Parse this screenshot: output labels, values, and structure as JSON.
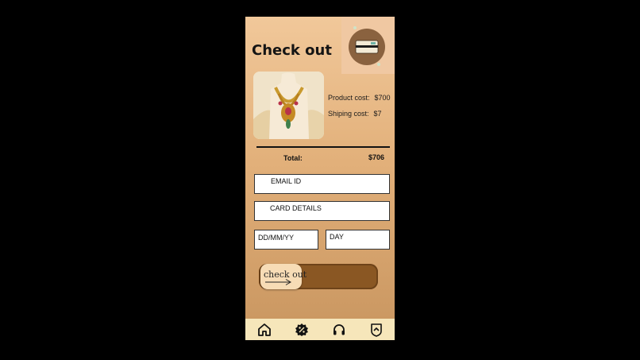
{
  "page": {
    "title": "Check out"
  },
  "product": {
    "product_cost_label": "Product cost:",
    "product_cost_value": "$700",
    "shipping_cost_label": "Shiping cost:",
    "shipping_cost_value": "$7"
  },
  "summary": {
    "total_label": "Total:",
    "total_value": "$706"
  },
  "form": {
    "email_label": "EMAIL ID",
    "card_label": "CARD DETAILS",
    "date_label": "DD/MM/YY",
    "day_label": "DAY"
  },
  "checkout": {
    "button_label": "check out"
  },
  "nav": {
    "items": [
      {
        "icon": "home-icon"
      },
      {
        "icon": "discount-icon"
      },
      {
        "icon": "headphones-icon"
      },
      {
        "icon": "shield-icon"
      }
    ]
  },
  "colors": {
    "accent": "#8a5723",
    "knob": "#f7dcb6",
    "navbar": "#f6e6ba"
  }
}
